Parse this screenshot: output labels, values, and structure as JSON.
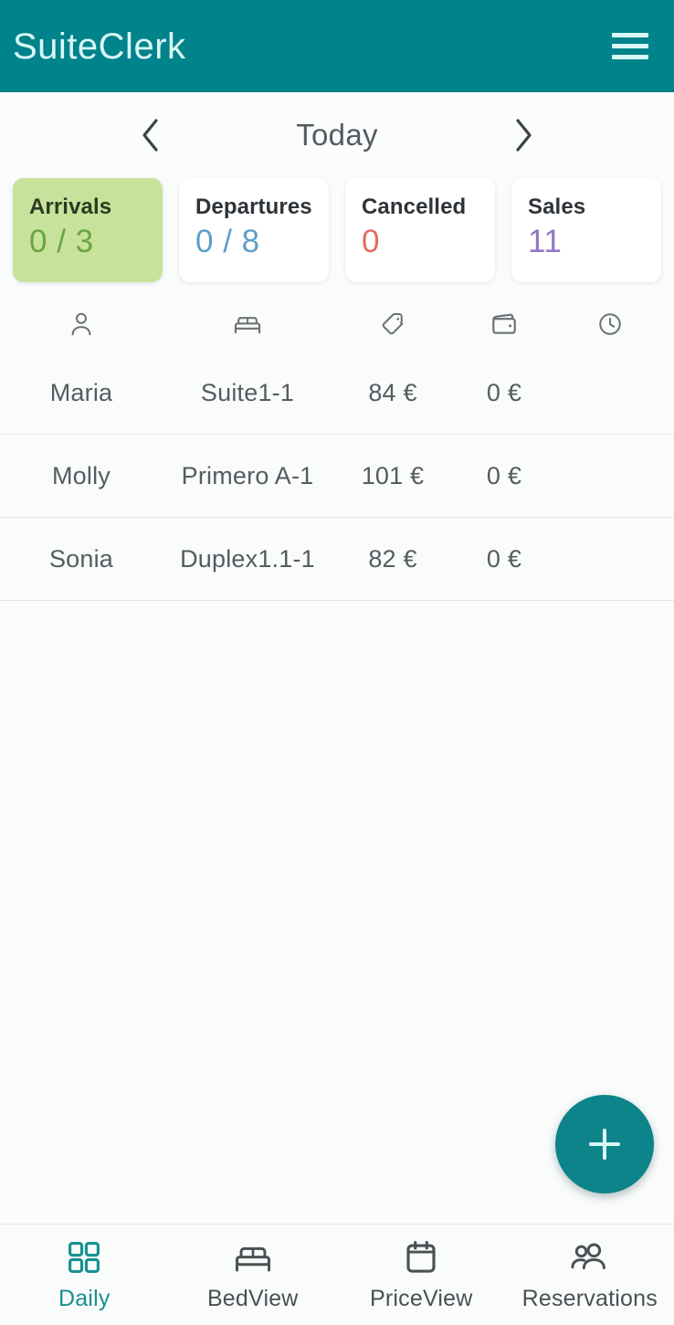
{
  "appbar": {
    "brand": "SuiteClerk",
    "menu_icon": "hamburger-menu-icon",
    "background": "#00838a",
    "foreground": "#d9f7f7"
  },
  "datenav": {
    "prev_icon": "chevron-left-icon",
    "next_icon": "chevron-right-icon",
    "title": "Today"
  },
  "stats": {
    "cards": [
      {
        "label": "Arrivals",
        "value": "0 / 3",
        "value_color": "#6aa544",
        "active": true,
        "bg": "#c7e29a"
      },
      {
        "label": "Departures",
        "value": "0 / 8",
        "value_color": "#5e9ec9",
        "active": false,
        "bg": "#ffffff"
      },
      {
        "label": "Cancelled",
        "value": "0",
        "value_color": "#e56a62",
        "active": false,
        "bg": "#ffffff"
      },
      {
        "label": "Sales",
        "value": "11",
        "value_color": "#9277c4",
        "active": false,
        "bg": "#ffffff"
      }
    ]
  },
  "table": {
    "columns": [
      {
        "icon": "person-icon",
        "key": "name"
      },
      {
        "icon": "bed-icon",
        "key": "room"
      },
      {
        "icon": "price-tag-icon",
        "key": "price"
      },
      {
        "icon": "wallet-icon",
        "key": "paid"
      },
      {
        "icon": "clock-icon",
        "key": "time"
      }
    ],
    "rows": [
      {
        "name": "Maria",
        "room": "Suite1-1",
        "price": "84 €",
        "paid": "0 €",
        "time": ""
      },
      {
        "name": "Molly",
        "room": "Primero A-1",
        "price": "101 €",
        "paid": "0 €",
        "time": ""
      },
      {
        "name": "Sonia",
        "room": "Duplex1.1-1",
        "price": "82 €",
        "paid": "0 €",
        "time": ""
      }
    ]
  },
  "fab": {
    "icon": "plus-icon",
    "label": "Add",
    "background": "#0d8489"
  },
  "bottomnav": {
    "active_color": "#17918f",
    "items": [
      {
        "label": "Daily",
        "icon": "grid-icon",
        "active": true
      },
      {
        "label": "BedView",
        "icon": "bed-icon",
        "active": false
      },
      {
        "label": "PriceView",
        "icon": "calendar-icon",
        "active": false
      },
      {
        "label": "Reservations",
        "icon": "people-icon",
        "active": false
      }
    ]
  }
}
